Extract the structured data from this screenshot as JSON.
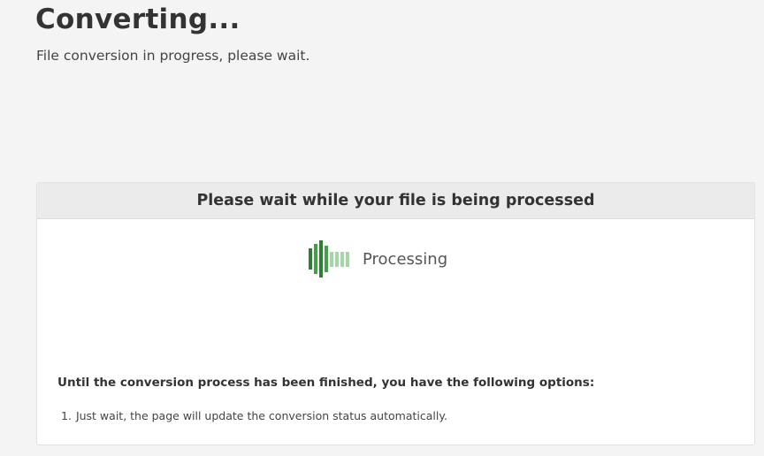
{
  "page": {
    "title": "Converting...",
    "subtitle": "File conversion in progress, please wait."
  },
  "panel": {
    "header": "Please wait while your file is being processed",
    "processing_label": "Processing",
    "options_heading": "Until the conversion process has been finished, you have the following options:",
    "options": [
      {
        "number": "1.",
        "text": "Just wait, the page will update the conversion status automatically."
      }
    ]
  },
  "colors": {
    "page_background": "#f4f4f4",
    "panel_header_background": "#ebebeb",
    "spinner_dark": "#2e7d32",
    "spinner_mid": "#43a047",
    "spinner_light": "#a5d6a7"
  },
  "spinner": {
    "icon": "processing-bars-icon",
    "bar_count": 8
  }
}
